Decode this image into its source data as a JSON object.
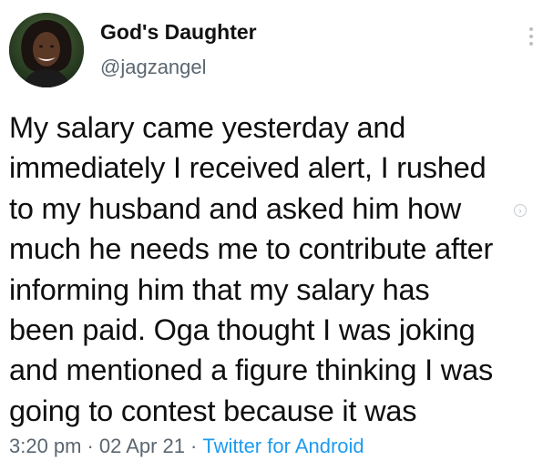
{
  "author": {
    "display_name": "God's Daughter",
    "handle": "@jagzangel",
    "avatar_icon": "profile-photo"
  },
  "tweet": {
    "text": "My salary came yesterday and\nimmediately I received alert, I rushed\nto my husband and asked him how\nmuch he needs me to contribute after\ninforming him that my salary has\nbeen paid. Oga thought I was joking\nand mentioned a figure thinking I was\ngoing to contest because it was",
    "time": "3:20 pm",
    "date": "02 Apr 21",
    "separator": "·",
    "source": "Twitter for Android"
  },
  "icons": {
    "more": "more-vertical-icon",
    "scroll": "scroll-indicator-icon"
  },
  "colors": {
    "text": "#0f0f0f",
    "secondary": "#5b6670",
    "link": "#1d9bf0",
    "background": "#ffffff"
  }
}
